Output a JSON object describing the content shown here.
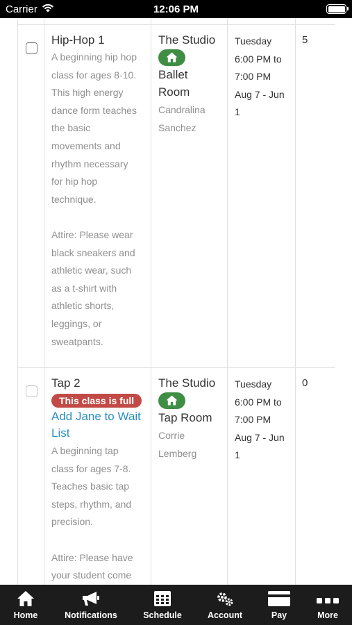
{
  "status_bar": {
    "carrier": "Carrier",
    "time": "12:06 PM"
  },
  "classes": [
    {
      "name": "Hip-Hop 1",
      "full": false,
      "desc_paragraphs": [
        [
          "A beginning hip hop",
          "class for ages 8-10.",
          "This high energy",
          "dance form teaches",
          "the basic",
          "movements and",
          "rhythm necessary",
          "for hip hop",
          "technique."
        ],
        [
          "Attire: Please wear",
          "black sneakers and",
          "athletic wear, such",
          "as a t-shirt with",
          "athletic shorts,",
          "leggings, or",
          "sweatpants."
        ]
      ],
      "location": "The Studio",
      "room": [
        "Ballet",
        "Room"
      ],
      "teacher": [
        "Candralina",
        "Sanchez"
      ],
      "schedule": [
        "Tuesday",
        "6:00 PM to",
        "7:00 PM",
        "Aug 7 - Jun",
        "1"
      ],
      "count": "5"
    },
    {
      "name": "Tap 2",
      "full": true,
      "full_badge": "This class is full",
      "waitlist_link": [
        "Add Jane to Wait",
        "List"
      ],
      "desc_paragraphs": [
        [
          "A beginning tap",
          "class for ages 7-8.",
          "Teaches basic tap",
          "steps, rhythm, and",
          "precision."
        ],
        [
          "Attire: Please have",
          "your student come"
        ]
      ],
      "location": "The Studio",
      "room": [
        "Tap Room"
      ],
      "teacher": [
        "Corrie",
        "Lemberg"
      ],
      "schedule": [
        "Tuesday",
        "6:00 PM to",
        "7:00 PM",
        "Aug 7 - Jun",
        "1"
      ],
      "count": "0"
    }
  ],
  "tab_bar": {
    "tabs": [
      {
        "label": "Home",
        "icon": "home-icon"
      },
      {
        "label": "Notifications",
        "icon": "megaphone-icon"
      },
      {
        "label": "Schedule",
        "icon": "calendar-icon"
      },
      {
        "label": "Account",
        "icon": "gears-icon"
      },
      {
        "label": "Pay",
        "icon": "credit-card-icon"
      },
      {
        "label": "More",
        "icon": "more-icon"
      }
    ]
  },
  "colors": {
    "badge_full": "#c24a46",
    "home_badge": "#3f8e44",
    "link": "#2a8ec2",
    "tab_bar": "#1c1c1c"
  }
}
